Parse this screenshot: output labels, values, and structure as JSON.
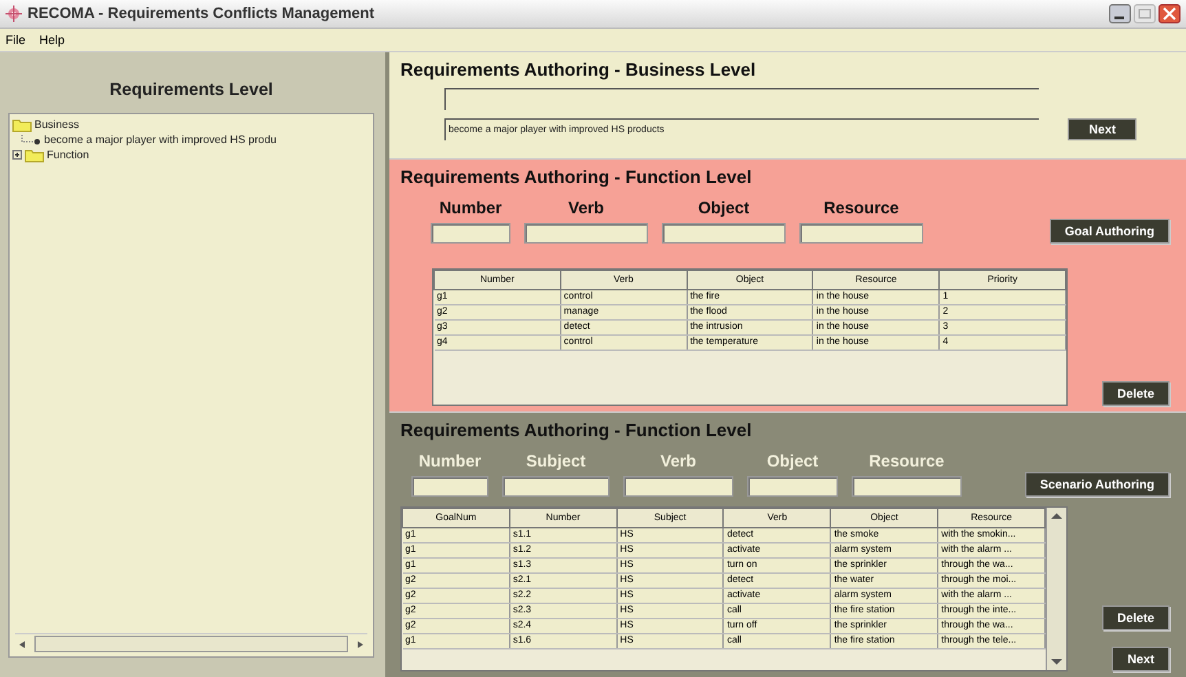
{
  "window": {
    "title": "RECOMA - Requirements Conflicts Management"
  },
  "menu": [
    "File",
    "Help"
  ],
  "tree": {
    "heading": "Requirements Level",
    "items": [
      {
        "label": "Business",
        "expanded": true,
        "children": [
          {
            "label": "become a major player with improved HS produ"
          }
        ]
      },
      {
        "label": "Function",
        "expanded": false
      }
    ]
  },
  "business": {
    "title": "Requirements Authoring - Business Level",
    "text": "become a major player with improved HS products",
    "button": "Next"
  },
  "goals": {
    "title": "Requirements Authoring - Function Level",
    "fields": [
      "Number",
      "Verb",
      "Object",
      "Resource"
    ],
    "button": "Goal Authoring",
    "columns": [
      "Number",
      "Verb",
      "Object",
      "Resource",
      "Priority"
    ],
    "rows": [
      [
        "g1",
        "control",
        "the fire",
        "in the house",
        "1"
      ],
      [
        "g2",
        "manage",
        "the flood",
        "in the house",
        "2"
      ],
      [
        "g3",
        "detect",
        "the intrusion",
        "in the house",
        "3"
      ],
      [
        "g4",
        "control",
        "the temperature",
        "in the house",
        "4"
      ]
    ],
    "side_buttons": [
      "Delete"
    ]
  },
  "scenarios": {
    "title": "Requirements Authoring - Function Level",
    "fields": [
      "Number",
      "Subject",
      "Verb",
      "Object",
      "Resource"
    ],
    "button": "Scenario Authoring",
    "columns": [
      "GoalNum",
      "Number",
      "Subject",
      "Verb",
      "Object",
      "Resource"
    ],
    "rows": [
      [
        "g1",
        "s1.1",
        "HS",
        "detect",
        "the smoke",
        "with the smokin..."
      ],
      [
        "g1",
        "s1.2",
        "HS",
        "activate",
        "alarm system",
        "with the alarm ..."
      ],
      [
        "g1",
        "s1.3",
        "HS",
        "turn on",
        "the sprinkler",
        "through the wa..."
      ],
      [
        "g2",
        "s2.1",
        "HS",
        "detect",
        "the water",
        "through the moi..."
      ],
      [
        "g2",
        "s2.2",
        "HS",
        "activate",
        "alarm system",
        "with the alarm ..."
      ],
      [
        "g2",
        "s2.3",
        "HS",
        "call",
        "the fire station",
        "through the inte..."
      ],
      [
        "g2",
        "s2.4",
        "HS",
        "turn off",
        "the sprinkler",
        "through the wa..."
      ],
      [
        "g1",
        "s1.6",
        "HS",
        "call",
        "the fire station",
        "through the tele..."
      ]
    ],
    "side_buttons": [
      "Delete",
      "Next"
    ]
  }
}
